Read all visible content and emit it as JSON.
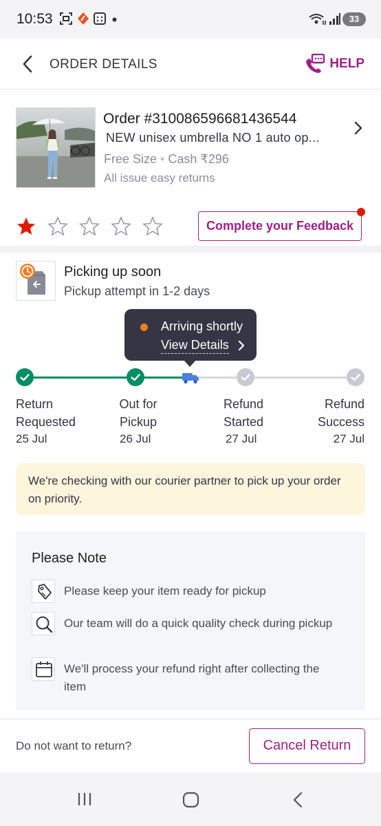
{
  "status_bar": {
    "time": "10:53",
    "battery": "33"
  },
  "header": {
    "title": "ORDER DETAILS",
    "help_label": "HELP"
  },
  "order": {
    "order_id": "Order #310086596681436544",
    "product_name": "NEW unisex umbrella NO 1 auto op...",
    "size": "Free Size",
    "payment": "Cash ₹296",
    "returns_note": "All issue easy returns",
    "rating": 1,
    "rating_max": 5,
    "feedback_button": "Complete your Feedback"
  },
  "pickup": {
    "title": "Picking up soon",
    "subtitle": "Pickup attempt in 1-2 days"
  },
  "tooltip": {
    "status": "Arriving shortly",
    "link": "View Details"
  },
  "tracker": {
    "steps": [
      {
        "line1": "Return",
        "line2": "Requested",
        "date": "25 Jul",
        "state": "done"
      },
      {
        "line1": "Out for",
        "line2": "Pickup",
        "date": "26 Jul",
        "state": "done"
      },
      {
        "line1": "Refund",
        "line2": "Started",
        "date": "27 Jul",
        "state": "pending"
      },
      {
        "line1": "Refund",
        "line2": "Success",
        "date": "27 Jul",
        "state": "pending"
      }
    ]
  },
  "info_message": "We're checking with our courier partner to pick up your order on priority.",
  "note": {
    "title": "Please Note",
    "items": [
      {
        "icon": "tag-icon",
        "text": "Please keep your item ready for pickup"
      },
      {
        "icon": "search-icon",
        "text": "Our team will do a quick quality check during pickup"
      },
      {
        "icon": "calendar-icon",
        "text": "We'll process your refund right after collecting the item"
      }
    ]
  },
  "bottom": {
    "question": "Do not want to return?",
    "cancel_button": "Cancel Return"
  },
  "colors": {
    "brand": "#9f2089",
    "success": "#038d63",
    "star": "#e11900",
    "info_bg": "#fef5dd"
  }
}
